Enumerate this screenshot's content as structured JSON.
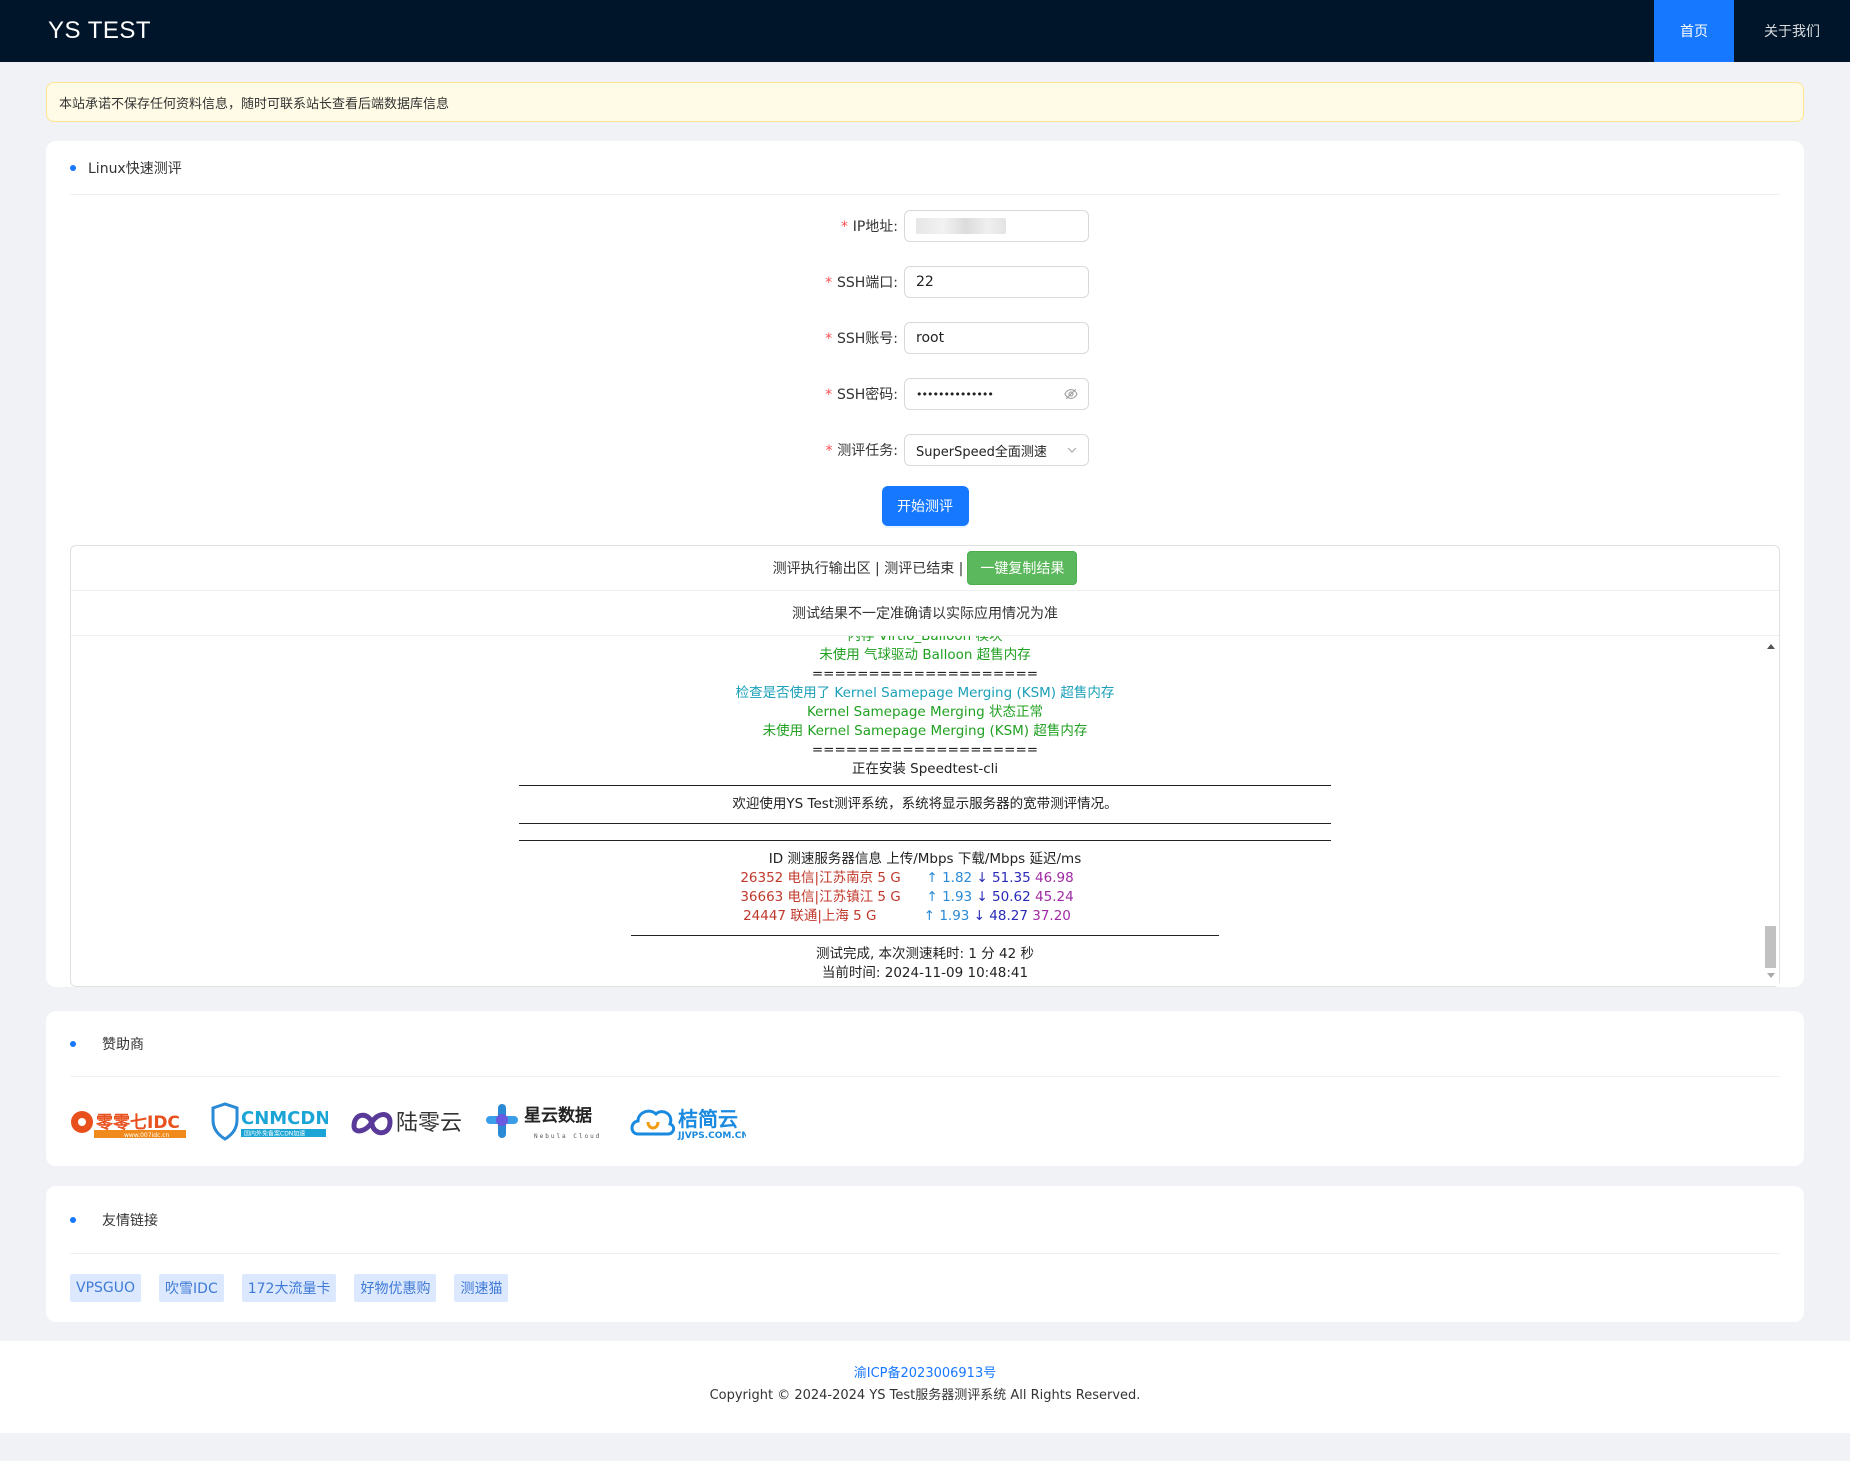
{
  "header": {
    "brand": "YS TEST",
    "nav": [
      "首页",
      "关于我们"
    ]
  },
  "notice": "本站承诺不保存任何资料信息，随时可联系站长查看后端数据库信息",
  "test_card": {
    "title": "Linux快速测评",
    "fields": {
      "ip": {
        "label": "IP地址:",
        "value": ""
      },
      "port": {
        "label": "SSH端口:",
        "value": "22"
      },
      "user": {
        "label": "SSH账号:",
        "value": "root"
      },
      "password": {
        "label": "SSH密码:",
        "value": "••••••••••••••"
      },
      "task": {
        "label": "测评任务:",
        "value": "SuperSpeed全面测速"
      }
    },
    "required_mark": "*",
    "start_button": "开始测评",
    "output": {
      "header_text": "测评执行输出区 | 测评已结束 |",
      "copy_button": "一键复制结果",
      "subheader": "测试结果不一定准确请以实际应用情况为准",
      "log": {
        "partial": "内存 Virtio_Balloon 模块",
        "balloon": "未使用 气球驱动 Balloon 超售内存",
        "sep1": "====================",
        "ksm_check": "检查是否使用了 Kernel Samepage Merging (KSM) 超售内存",
        "ksm_ok": "Kernel Samepage Merging 状态正常",
        "ksm_unused": "未使用 Kernel Samepage Merging (KSM) 超售内存",
        "sep2": "====================",
        "installing": "正在安装 Speedtest-cli",
        "welcome": "欢迎使用YS Test测评系统，系统将显示服务器的宽带测评情况。",
        "table_header": "ID 测速服务器信息 上传/Mbps 下载/Mbps 延迟/ms",
        "rows": [
          {
            "id_name": "26352 电信|江苏南京 5 G",
            "up": "↑ 1.82",
            "down": "↓ 51.35",
            "lat": "46.98"
          },
          {
            "id_name": "36663 电信|江苏镇江 5 G",
            "up": "↑ 1.93",
            "down": "↓ 50.62",
            "lat": "45.24"
          },
          {
            "id_name": "24447 联通|上海 5 G",
            "up": "↑ 1.93",
            "down": "↓ 48.27",
            "lat": "37.20"
          }
        ],
        "done": "测试完成, 本次测速耗时: 1 分 42 秒",
        "time": "当前时间: 2024-11-09 10:48:41"
      }
    }
  },
  "sponsors": {
    "title": "赞助商",
    "logos": [
      {
        "text": "零零七IDC",
        "sub": "www.007idc.cn"
      },
      {
        "text": "CNMCDN",
        "sub": "国内外免备案CDN加速"
      },
      {
        "text": "陆零云"
      },
      {
        "text": "星云数据",
        "sub": "Nebula Cloud"
      },
      {
        "text": "桔简云",
        "sub": "JJVPS.COM.CN"
      }
    ]
  },
  "links": {
    "title": "友情链接",
    "items": [
      "VPSGUO",
      "吹雪IDC",
      "172大流量卡",
      "好物优惠购",
      "测速猫"
    ]
  },
  "footer": {
    "icp": "渝ICP备2023006913号",
    "copyright": "Copyright © 2024-2024 YS Test服务器测评系统 All Rights Reserved."
  },
  "colors": {
    "header_bg": "#001529",
    "primary": "#1677ff",
    "success": "#5cb85c",
    "notice_bg": "#fffbe6"
  }
}
